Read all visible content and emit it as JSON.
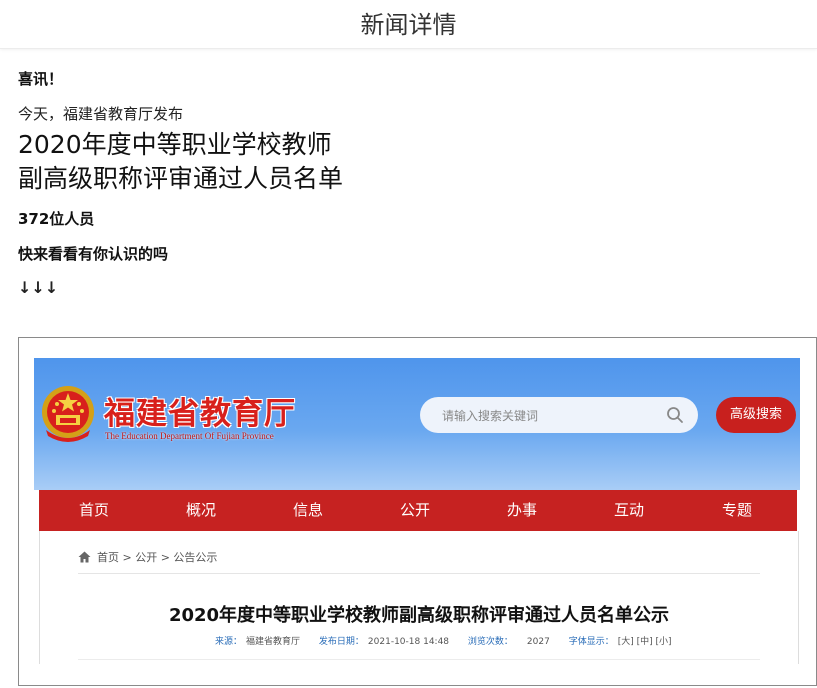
{
  "header": {
    "title": "新闻详情"
  },
  "article": {
    "line1": "喜讯！",
    "line2": "今天，福建省教育厅发布",
    "line3": "2020年度中等职业学校教师",
    "line4": "副高级职称评审通过人员名单",
    "line5": "372位人员",
    "line6": "快来看看有你认识的吗",
    "line7": "↓↓↓"
  },
  "embedded_screenshot": {
    "site_name": "福建省教育厅",
    "site_subtitle": "The Education Department Of Fujian Province",
    "search": {
      "placeholder": "请输入搜索关键词"
    },
    "advanced_search_label": "高级搜索",
    "nav": [
      "首页",
      "概况",
      "信息",
      "公开",
      "办事",
      "互动",
      "专题"
    ],
    "breadcrumb": "首页 > 公开 > 公告公示",
    "news_title": "2020年度中等职业学校教师副高级职称评审通过人员名单公示",
    "meta": {
      "source_label": "来源：",
      "source_value": "福建省教育厅",
      "date_label": "发布日期：",
      "date_value": "2021-10-18 14:48",
      "views_label": "浏览次数：",
      "views_value": "2027",
      "font_label": "字体显示：",
      "font_options": "[大] [中] [小]"
    },
    "colors": {
      "brand_red": "#c62221",
      "hero_blue": "#4f95ec"
    }
  }
}
